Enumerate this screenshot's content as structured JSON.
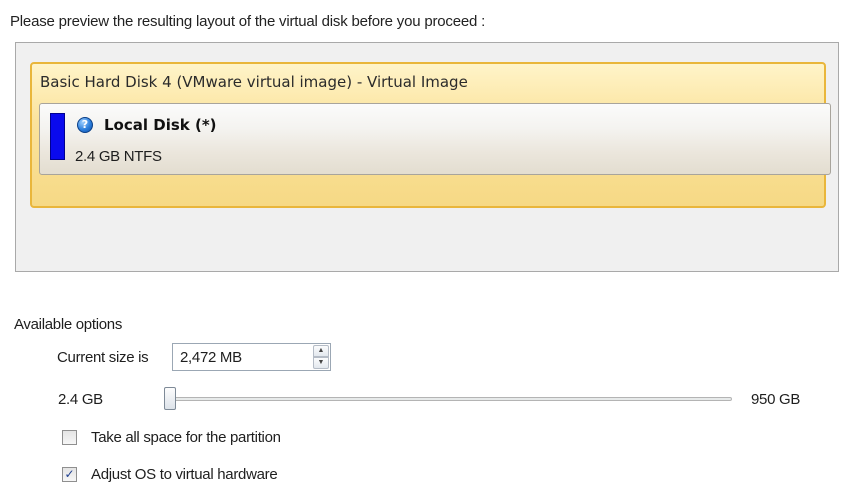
{
  "instruction": "Please preview the resulting layout of the virtual disk before you proceed :",
  "disk": {
    "title": "Basic Hard Disk 4 (VMware virtual image) - Virtual Image",
    "partition": {
      "name": "Local Disk (*)",
      "size_fs": "2.4 GB NTFS",
      "icon": "info-icon",
      "usage_color": "#0a0aee"
    }
  },
  "options": {
    "section_label": "Available options",
    "current_size_label": "Current size is",
    "current_size_value": "2,472 MB",
    "slider": {
      "min_label": "2.4 GB",
      "max_label": "950 GB",
      "position": 0.0
    },
    "take_all_space": {
      "label": "Take all space for the partition",
      "checked": false
    },
    "adjust_os": {
      "label": "Adjust OS to virtual hardware",
      "checked": true
    }
  },
  "colors": {
    "selection_border": "#e9b63b",
    "selection_fill": "#fbe39d",
    "partition_bar": "#0a0aee"
  }
}
